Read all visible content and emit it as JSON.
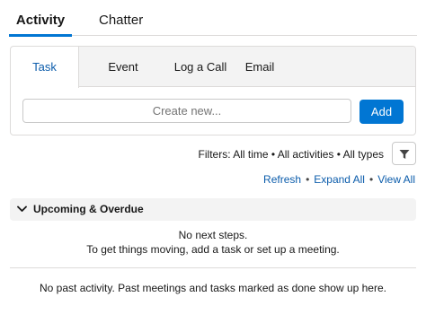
{
  "top_tabs": [
    {
      "label": "Activity",
      "active": true
    },
    {
      "label": "Chatter",
      "active": false
    }
  ],
  "composer": {
    "tabs": [
      {
        "label": "Task",
        "active": true
      },
      {
        "label": "Event",
        "active": false
      },
      {
        "label": "Log a Call",
        "active": false
      },
      {
        "label": "Email",
        "active": false
      }
    ],
    "input_placeholder": "Create new...",
    "add_label": "Add"
  },
  "filters": {
    "text": "Filters: All time • All activities • All types",
    "icon": "filter-icon"
  },
  "links": {
    "refresh": "Refresh",
    "expand_all": "Expand All",
    "view_all": "View All",
    "separator": "•"
  },
  "upcoming": {
    "title": "Upcoming & Overdue",
    "line1": "No next steps.",
    "line2": "To get things moving, add a task or set up a meeting."
  },
  "past": {
    "text": "No past activity. Past meetings and tasks marked as done show up here."
  },
  "colors": {
    "brand": "#0176d3",
    "link": "#0b5cab",
    "border": "#dddbda",
    "panel_bg": "#f3f3f3"
  }
}
